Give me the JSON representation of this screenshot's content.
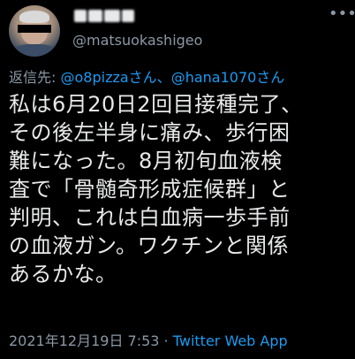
{
  "author": {
    "display_name": "",
    "handle": "@matsuokashigeo"
  },
  "reply": {
    "prefix": "返信先:",
    "mention_1": "@o8pizza",
    "joiner_1": "さん、",
    "mention_2": "@hana1070",
    "joiner_2": "さん"
  },
  "tweet": {
    "lines": [
      "私は6月20日2回目接種完了、",
      "その後左半身に痛み、歩行困",
      "難になった。8月初旬血液検",
      "査で「骨髄奇形成症候群」と",
      "判明、これは白血病一歩手前",
      "の血液ガン。ワクチンと関係",
      "あるかな。"
    ]
  },
  "meta": {
    "timestamp": "2021年12月19日 7:53",
    "separator": " · ",
    "app": "Twitter Web App"
  },
  "icons": {
    "more": "more-horizontal-icon",
    "avatar": "profile-avatar"
  },
  "colors": {
    "background": "#000000",
    "text": "#e7e9ea",
    "secondary": "#8b98a5",
    "link": "#1d9bf0"
  }
}
